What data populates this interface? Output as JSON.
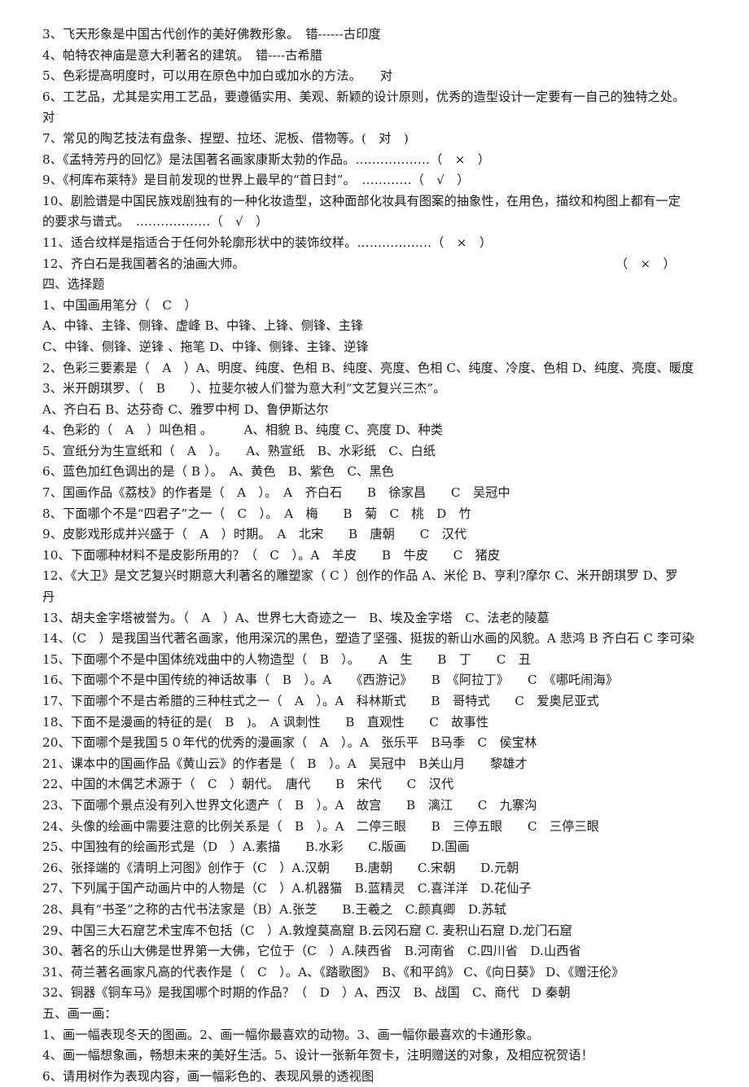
{
  "document": {
    "true_false_section": {
      "items": [
        {
          "id": "tf3",
          "text": "3、飞天形象是中国古代创作的美好佛教形象。　错------古印度"
        },
        {
          "id": "tf4",
          "text": "4、帕特农神庙是意大利著名的建筑。　错----古希腊"
        },
        {
          "id": "tf5",
          "text": "5、色彩提高明度时，可以用在原色中加白或加水的方法。　　对"
        },
        {
          "id": "tf6",
          "text": "6、工艺品，尤其是实用工艺品，要遵循实用、美观、新颖的设计原则，优秀的造型设计一定要有一自己的独特之处。"
        },
        {
          "id": "tf6b",
          "text": "对"
        },
        {
          "id": "tf7",
          "text": "7、常见的陶艺技法有盘条、捏塑、拉坯、泥板、借物等。(　对　)"
        },
        {
          "id": "tf8",
          "text": "8、《孟特芳丹的回忆》是法国著名画家康斯太勃的作品。………………（　×　）"
        },
        {
          "id": "tf9",
          "text": "9、《柯库布莱特》是目前发现的世界上最早的“首日封”。　…………（　√　）"
        },
        {
          "id": "tf10",
          "text": "10、剧脸谱是中国民族戏剧独有的一种化妆造型，这种面部化妆具有图案的抽象性，在用色，描纹和构图上都有一定"
        },
        {
          "id": "tf10b",
          "text": "的要求与谱式。　………………（　√　）"
        },
        {
          "id": "tf11",
          "text": "11、适合纹样是指适合于任何外轮廓形状中的装饰纹样。………………（　×　）"
        }
      ],
      "item12_text": "12、齐白石是我国著名的油画大师。",
      "item12_mark": "（　×　）"
    },
    "choice_section": {
      "heading": "四、选择题",
      "items": [
        {
          "id": "c1",
          "text": "1、中国画用笔分（　C　）"
        },
        {
          "id": "c1a",
          "text": "A、中锋、主锋、侧锋、虚峰 B、中锋、上锋、侧锋、主锋"
        },
        {
          "id": "c1b",
          "text": "C、中锋、侧锋、逆锋 、拖笔 D、中锋、侧锋、主锋、逆锋"
        },
        {
          "id": "c2",
          "text": "2、色彩三要素是（　A　）A、明度、纯度、色相 B、纯度、亮度、色相 C、纯度、冷度、色相 D、纯度、亮度、暖度"
        },
        {
          "id": "c3",
          "text": "3、米开朗琪罗、（　B　　）、拉斐尔被人们誉为意大利“文艺复兴三杰”。"
        },
        {
          "id": "c3a",
          "text": "A、齐白石 B、达芬奇 C、雅罗中柯 D、鲁伊斯达尔"
        },
        {
          "id": "c4",
          "text": "4、色彩的（　A　）叫色相 。　　　A、相貌 B、纯度 C、亮度 D、种类"
        },
        {
          "id": "c5",
          "text": "5、宣纸分为生宣纸和（　A　）。　　A、熟宣纸　B、水彩纸　C、白纸"
        },
        {
          "id": "c6",
          "text": "6、蓝色加红色调出的是（ B ）。　A、黄色　B、紫色　C、黑色"
        },
        {
          "id": "c7",
          "text": "7、国画作品《荔枝》的作者是（　A　）。　A　齐白石　　B　徐家昌　　C　吴冠中"
        },
        {
          "id": "c8",
          "text": "8、下面哪个不是“四君子”之一（　C　）。　A　梅　　B　菊　C　桃　D　竹"
        },
        {
          "id": "c9",
          "text": "9、皮影戏形成并兴盛于（　A　）时期。　A　北宋　　B　唐朝　　C　汉代"
        },
        {
          "id": "c10",
          "text": "10、下面哪种材料不是皮影所用的？（　C　）。A　羊皮　　B　牛皮　　C　猪皮"
        },
        {
          "id": "c12",
          "text": "12、《大卫》是文艺复兴时期意大利著名的雕塑家（ C ）创作的作品 A、米伦 B、亨利?摩尔 C、米开朗琪罗 D、罗"
        },
        {
          "id": "c12b",
          "text": "丹"
        },
        {
          "id": "c13",
          "text": "13、胡夫金字塔被誉为。（　A　）A、世界七大奇迹之一　B、埃及金字塔　C、法老的陵墓"
        },
        {
          "id": "c14",
          "text": "14、（C　）是我国当代著名画家，他用深沉的黑色，塑造了坚强、挺拔的新山水画的风貌。A 悲鸿 B 齐白石 C 李可染"
        },
        {
          "id": "c15",
          "text": "15、下面哪个不是中国体统戏曲中的人物造型（　B　）。　　A　生　　B　丁　　C　丑"
        },
        {
          "id": "c16",
          "text": "16、下面哪个不是中国传统的神话故事（　B　）。A　　《西游记》　　B　《阿拉丁》　　C　《哪吒闹海》"
        },
        {
          "id": "c17",
          "text": "17、下面哪个不是古希腊的三种柱式之一（　A　）。A　科林斯式　　B　哥特式　　C　爱奥尼亚式"
        },
        {
          "id": "c18",
          "text": "18、下面不是漫画的特征的是(　B　)。　A 讽刺性　　B　直观性　　C　故事性"
        },
        {
          "id": "c20",
          "text": "20、下面哪个是我国５０年代的优秀的漫画家（　A　）。A　张乐平　B马季　C　侯宝林"
        },
        {
          "id": "c21",
          "text": "21、课本中的国画作品《黄山云》的作者是（　B　）。A　吴冠中　B关山月　　黎雄才"
        },
        {
          "id": "c22",
          "text": "22、中国的木偶艺术源于（　C　）朝代。　唐代　　B　宋代　　C　汉代"
        },
        {
          "id": "c23",
          "text": "23、下面哪个景点没有列入世界文化遗产（　B　）。A　故宫　　B　漓江　　C　九寨沟"
        },
        {
          "id": "c24",
          "text": "24、头像的绘画中需要注意的比例关系是（　B　）。A　二停三眼　　B　三停五眼　　C　三停三眼"
        },
        {
          "id": "c25",
          "text": "25、中国独有的绘画形式是（D　）A.素描　　B.水彩　　C.版画　　D.国画"
        },
        {
          "id": "c26",
          "text": "26、张择端的《清明上河图》创作于（C　）A.汉朝　　B.唐朝　　C.宋朝　　D.元朝"
        },
        {
          "id": "c27",
          "text": "27、下列属于国产动画片中的人物是（C　）A.机器猫　B.蓝精灵　C.喜洋洋　D.花仙子"
        },
        {
          "id": "c28",
          "text": "28、具有“书圣”之称的古代书法家是（B）A.张芝　　B.王羲之　C.颜真卿　D.苏轼"
        },
        {
          "id": "c29",
          "text": "29、中国三大石窟艺术宝库不包括（C　）A.敦煌莫高窟 B.云冈石窟 C. 麦积山石窟 D.龙门石窟"
        },
        {
          "id": "c30",
          "text": "30、著名的乐山大佛是世界第一大佛，它位于（C　）A.陕西省　B.河南省　C.四川省　D.山西省"
        },
        {
          "id": "c31",
          "text": "31、荷兰著名画家凡高的代表作是（　C　）。A、《踏歌图》　B、《和平鸽》 C、《向日葵》 D、《赠汪伦》"
        },
        {
          "id": "c32",
          "text": "32、铜器《铜车马》是我国哪个时期的作品？（　D　）A、西汉　B、战国　C、商代　D 秦朝"
        }
      ]
    },
    "draw_section": {
      "heading": "五、画一画：",
      "items": [
        {
          "id": "d1",
          "text": "1、画一幅表现冬天的图画。2、画一幅你最喜欢的动物。3、画一幅你最喜欢的卡通形象。"
        },
        {
          "id": "d4",
          "text": "4、画一幅想象画，畅想未来的美好生活。5、设计一张新年贺卡，注明赠送的对象，及相应祝贺语！"
        },
        {
          "id": "d6",
          "text": "6、请用树作为表现内容，画一幅彩色的、表现风景的透视图"
        }
      ]
    }
  }
}
